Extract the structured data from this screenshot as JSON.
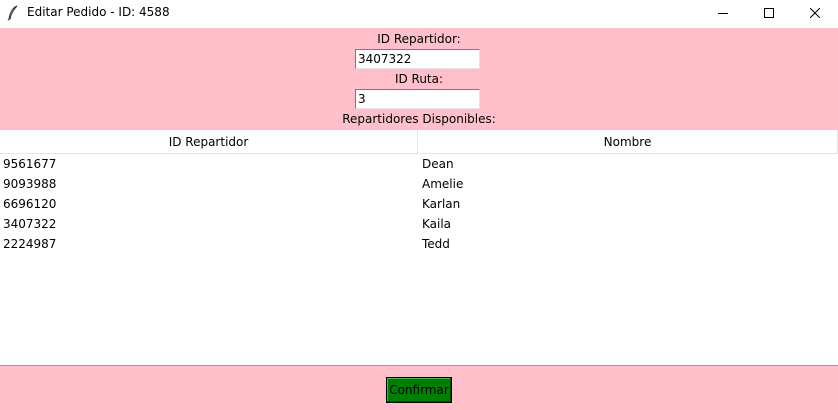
{
  "window": {
    "title": "Editar Pedido - ID: 4588",
    "icon": "feather-icon",
    "controls": [
      "minimize-icon",
      "maximize-icon",
      "close-icon"
    ]
  },
  "form": {
    "repartidor_label": "ID Repartidor:",
    "repartidor_value": "3407322",
    "ruta_label": "ID Ruta:",
    "ruta_value": "3",
    "disponibles_label": "Repartidores Disponibles:"
  },
  "table": {
    "columns": [
      "ID Repartidor",
      "Nombre"
    ],
    "rows": [
      [
        "9561677",
        "Dean"
      ],
      [
        "9093988",
        "Amelie"
      ],
      [
        "6696120",
        "Karlan"
      ],
      [
        "3407322",
        "Kaila"
      ],
      [
        "2224987",
        "Tedd"
      ]
    ]
  },
  "footer": {
    "confirm_label": "Confirmar"
  },
  "colors": {
    "panel_bg": "#ffc0cb",
    "confirm_bg": "#008000"
  }
}
